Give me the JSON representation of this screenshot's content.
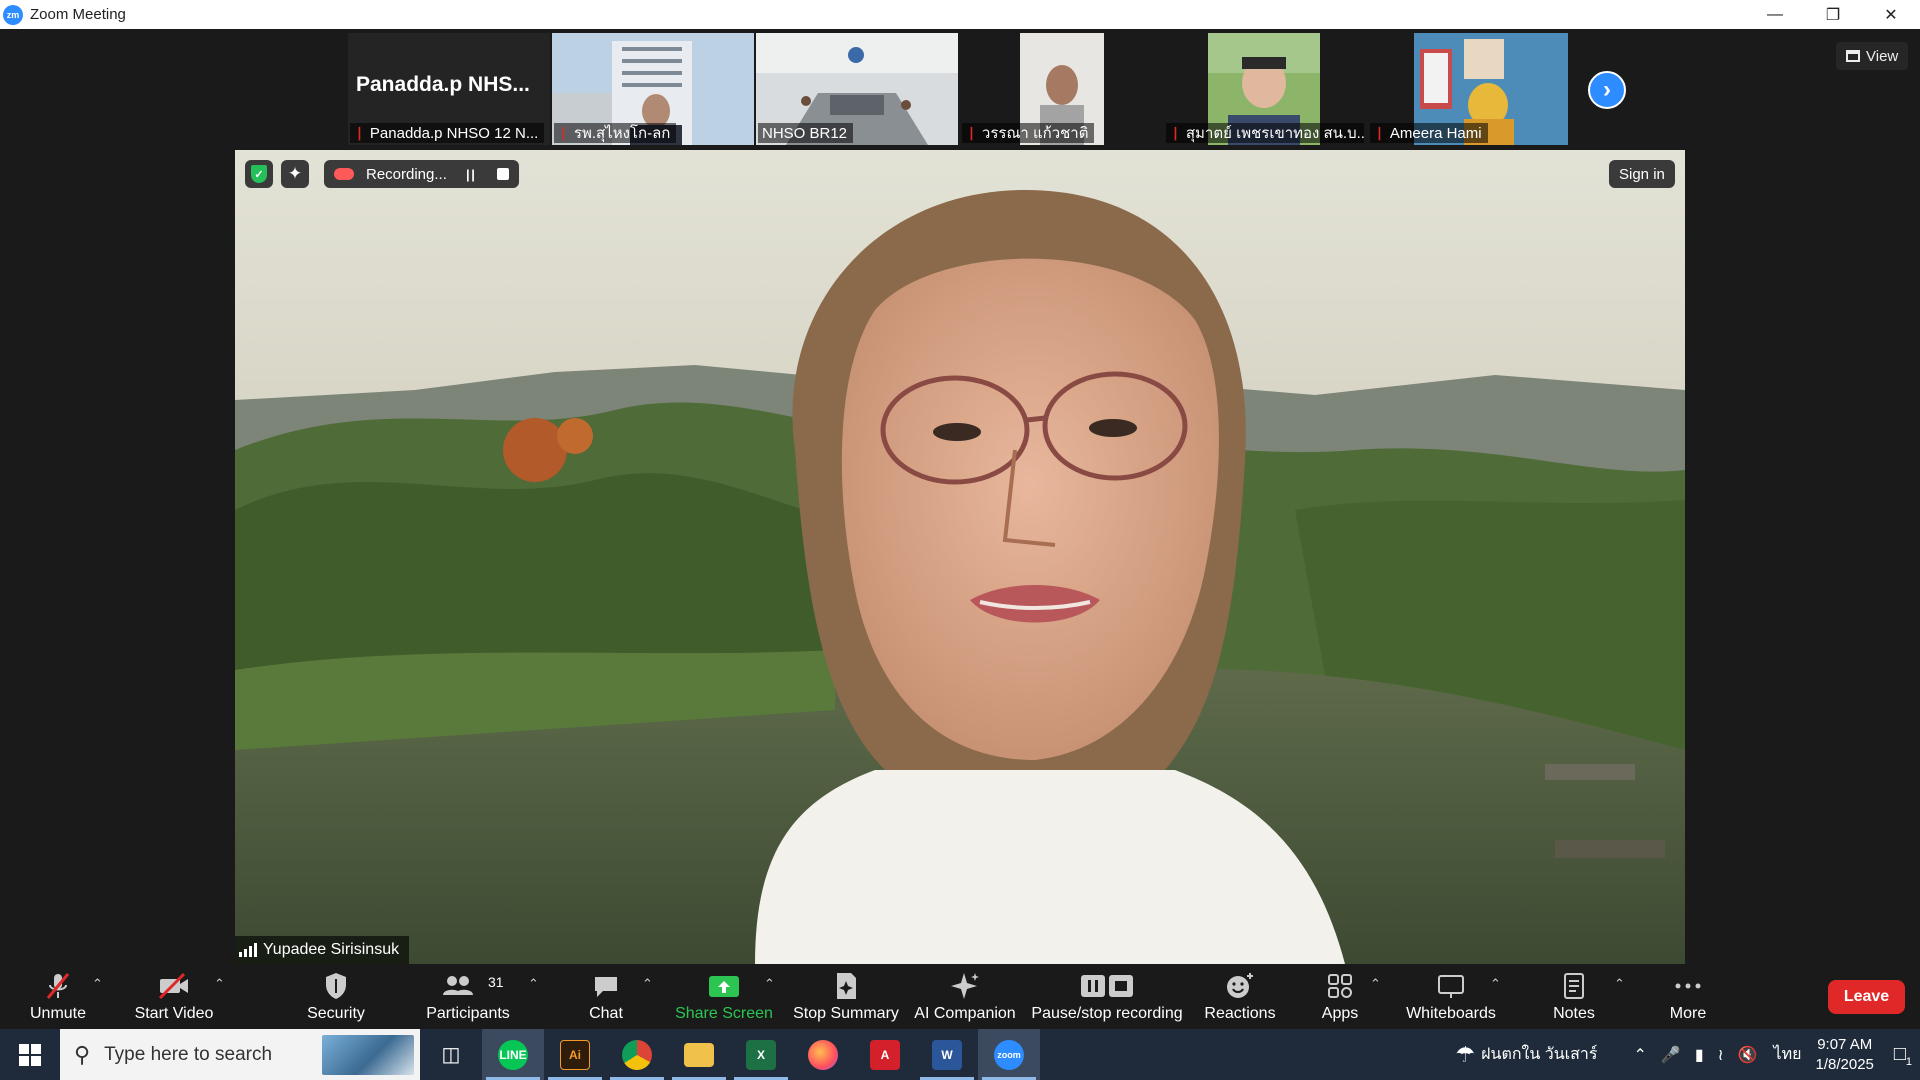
{
  "window": {
    "title": "Zoom Meeting",
    "app_icon": "zm"
  },
  "gallery": {
    "tiles": [
      {
        "name": "Panadda.p NHSO 12 N...",
        "big_label": "Panadda.p NHS...",
        "muted": true,
        "video": false
      },
      {
        "name": "รพ.สุไหงโก-ลก",
        "muted": true,
        "video": true
      },
      {
        "name": "NHSO BR12",
        "muted": false,
        "video": true
      },
      {
        "name": "วรรณา แก้วชาติ",
        "muted": true,
        "video": true
      },
      {
        "name": "สุมาตย์ เพชรเขาทอง สน.บ...",
        "muted": true,
        "video": true
      },
      {
        "name": "Ameera Hami",
        "muted": true,
        "video": true
      }
    ],
    "view_label": "View"
  },
  "main": {
    "speaker_name": "Yupadee Sirisinsuk",
    "recording_label": "Recording...",
    "signin_label": "Sign in"
  },
  "toolbar": {
    "unmute": "Unmute",
    "start_video": "Start Video",
    "security": "Security",
    "participants": "Participants",
    "participants_count": "31",
    "chat": "Chat",
    "share_screen": "Share Screen",
    "stop_summary": "Stop Summary",
    "ai_companion": "AI Companion",
    "pause_stop_recording": "Pause/stop recording",
    "reactions": "Reactions",
    "apps": "Apps",
    "whiteboards": "Whiteboards",
    "notes": "Notes",
    "more": "More",
    "leave": "Leave"
  },
  "taskbar": {
    "search_placeholder": "Type here to search",
    "weather": "ฝนตกใน วันเสาร์",
    "language": "ไทย",
    "time": "9:07 AM",
    "date": "1/8/2025",
    "notification_count": "1"
  },
  "colors": {
    "zoom_blue": "#2d8cff",
    "leave_red": "#e02828",
    "share_green": "#2dc552"
  }
}
